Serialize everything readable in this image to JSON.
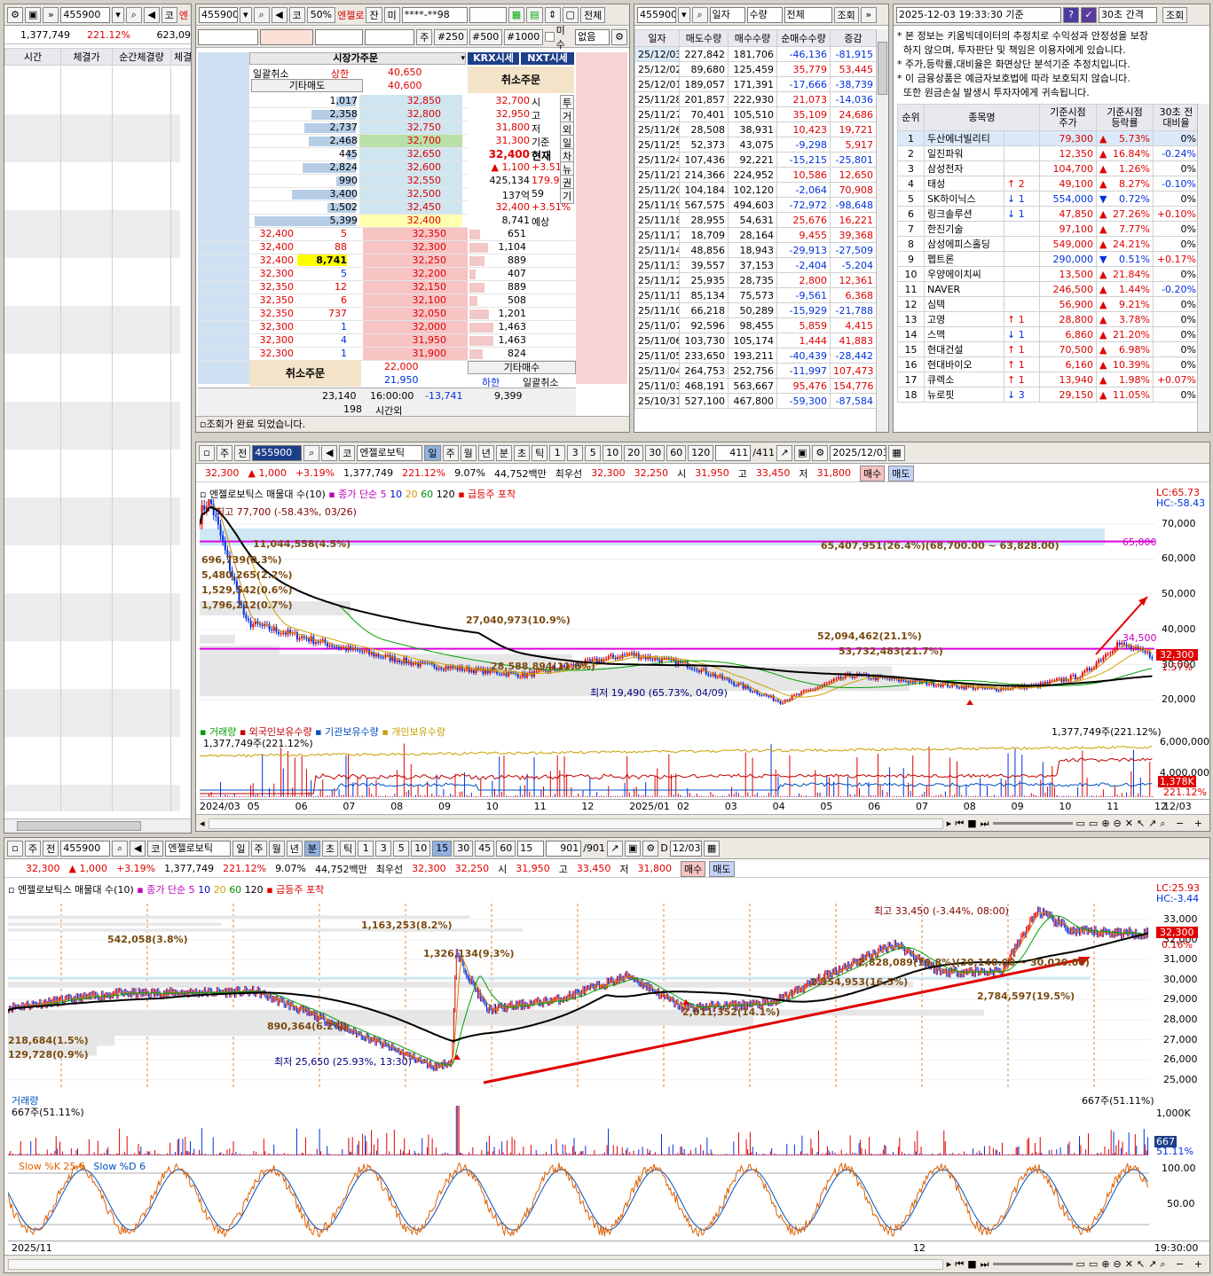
{
  "p1": {
    "code": "455900",
    "cat": "코",
    "name": "엔",
    "price": "1,377,749",
    "ratio": "221.12%",
    "extra": "623,09",
    "headers": [
      "시간",
      "체결가",
      "순간체결량",
      "체결"
    ]
  },
  "p2": {
    "code": "455900",
    "cat": "코",
    "pct": "50%",
    "name": "엔젤로",
    "jan": "잔",
    "mi": "미",
    "account": "****-**98",
    "whole": "전체",
    "ju": "주",
    "q250": "#250",
    "q500": "#500",
    "q1000": "#1000",
    "misu": "미수",
    "none": "없음",
    "market_order": "시장가주문",
    "cancel_label": "일괄취소",
    "etc_sell": "기타매도",
    "upper": "상한",
    "upper_price": "40,650",
    "price2": "40,600",
    "krx": "KRX시세",
    "nxt": "NXT시세",
    "cancel_order": "취소주문",
    "asks": [
      {
        "qty": "1,017",
        "price": "32,850",
        "bar": 0.18
      },
      {
        "qty": "2,358",
        "price": "32,800",
        "bar": 0.42
      },
      {
        "qty": "2,737",
        "price": "32,750",
        "bar": 0.48
      },
      {
        "qty": "2,468",
        "price": "32,700",
        "bar": 0.44
      },
      {
        "qty": "445",
        "price": "32,650",
        "bar": 0.08
      },
      {
        "qty": "2,824",
        "price": "32,600",
        "bar": 0.5
      },
      {
        "qty": "990",
        "price": "32,550",
        "bar": 0.18
      },
      {
        "qty": "3,400",
        "price": "32,500",
        "bar": 0.6
      },
      {
        "qty": "1,502",
        "price": "32,450",
        "bar": 0.27
      },
      {
        "qty": "5,399",
        "price": "32,400",
        "bar": 0.95
      }
    ],
    "info_rows": [
      {
        "v": "32,700",
        "k": "시",
        "side": "투"
      },
      {
        "v": "32,950",
        "k": "고",
        "side": "거"
      },
      {
        "v": "31,800",
        "k": "저",
        "side": "외"
      },
      {
        "v": "31,300",
        "k": "기준",
        "side": "일"
      },
      {
        "v": "32,400",
        "k": "현재",
        "side": "차"
      },
      {
        "v": "▲ 1,100",
        "k": "+3.51%",
        "side": "뉴"
      },
      {
        "v": "425,134",
        "k": "179.99",
        "side": "권"
      },
      {
        "v": "137억",
        "k": "59",
        "side": "기"
      },
      {
        "v": "32,400",
        "k": "+3.51%",
        "side": ""
      },
      {
        "v": "8,741",
        "k": "예상",
        "side": ""
      }
    ],
    "fills": [
      {
        "p": "32,400",
        "q": "5"
      },
      {
        "p": "32,400",
        "q": "88"
      },
      {
        "p": "32,400",
        "q": "8,741"
      },
      {
        "p": "32,300",
        "q": "5"
      },
      {
        "p": "32,350",
        "q": "12"
      },
      {
        "p": "32,350",
        "q": "6"
      },
      {
        "p": "32,350",
        "q": "737"
      },
      {
        "p": "32,300",
        "q": "1"
      },
      {
        "p": "32,300",
        "q": "4"
      },
      {
        "p": "32,300",
        "q": "1"
      }
    ],
    "bids": [
      {
        "price": "32,350",
        "qty": "651",
        "bar": 0.1
      },
      {
        "price": "32,300",
        "qty": "1,104",
        "bar": 0.18
      },
      {
        "price": "32,250",
        "qty": "889",
        "bar": 0.14
      },
      {
        "price": "32,200",
        "qty": "407",
        "bar": 0.06
      },
      {
        "price": "32,150",
        "qty": "889",
        "bar": 0.14
      },
      {
        "price": "32,100",
        "qty": "508",
        "bar": 0.08
      },
      {
        "price": "32,050",
        "qty": "1,201",
        "bar": 0.19
      },
      {
        "price": "32,000",
        "qty": "1,463",
        "bar": 0.23
      },
      {
        "price": "31,950",
        "qty": "1,463",
        "bar": 0.23
      },
      {
        "price": "31,900",
        "qty": "824",
        "bar": 0.13
      }
    ],
    "lower_p1": "22,000",
    "lower_p2": "21,950",
    "lower": "하한",
    "etc_buy": "기타매수",
    "sum_ask": "23,140",
    "time": "16:00:00",
    "diff": "-13,741",
    "sum_bid": "9,399",
    "after": "198",
    "after_label": "시간외",
    "status": "조회가 완료 되었습니다."
  },
  "p3": {
    "code": "455900",
    "sel1": "일자",
    "sel2": "수량",
    "sel3": "전체",
    "query": "조회",
    "headers": [
      "일자",
      "매도수량",
      "매수수량",
      "순매수수량",
      "증감"
    ],
    "rows": [
      [
        "25/12/03",
        "227,842",
        "181,706",
        "-46,136",
        "-81,915"
      ],
      [
        "25/12/02",
        "89,680",
        "125,459",
        "35,779",
        "53,445"
      ],
      [
        "25/12/01",
        "189,057",
        "171,391",
        "-17,666",
        "-38,739"
      ],
      [
        "25/11/28",
        "201,857",
        "222,930",
        "21,073",
        "-14,036"
      ],
      [
        "25/11/27",
        "70,401",
        "105,510",
        "35,109",
        "24,686"
      ],
      [
        "25/11/26",
        "28,508",
        "38,931",
        "10,423",
        "19,721"
      ],
      [
        "25/11/25",
        "52,373",
        "43,075",
        "-9,298",
        "5,917"
      ],
      [
        "25/11/24",
        "107,436",
        "92,221",
        "-15,215",
        "-25,801"
      ],
      [
        "25/11/21",
        "214,366",
        "224,952",
        "10,586",
        "12,650"
      ],
      [
        "25/11/20",
        "104,184",
        "102,120",
        "-2,064",
        "70,908"
      ],
      [
        "25/11/19",
        "567,575",
        "494,603",
        "-72,972",
        "-98,648"
      ],
      [
        "25/11/18",
        "28,955",
        "54,631",
        "25,676",
        "16,221"
      ],
      [
        "25/11/17",
        "18,709",
        "28,164",
        "9,455",
        "39,368"
      ],
      [
        "25/11/14",
        "48,856",
        "18,943",
        "-29,913",
        "-27,509"
      ],
      [
        "25/11/13",
        "39,557",
        "37,153",
        "-2,404",
        "-5,204"
      ],
      [
        "25/11/12",
        "25,935",
        "28,735",
        "2,800",
        "12,361"
      ],
      [
        "25/11/11",
        "85,134",
        "75,573",
        "-9,561",
        "6,368"
      ],
      [
        "25/11/10",
        "66,218",
        "50,289",
        "-15,929",
        "-21,788"
      ],
      [
        "25/11/07",
        "92,596",
        "98,455",
        "5,859",
        "4,415"
      ],
      [
        "25/11/06",
        "103,730",
        "105,174",
        "1,444",
        "41,883"
      ],
      [
        "25/11/05",
        "233,650",
        "193,211",
        "-40,439",
        "-28,442"
      ],
      [
        "25/11/04",
        "264,753",
        "252,756",
        "-11,997",
        "107,473"
      ],
      [
        "25/11/03",
        "468,191",
        "563,667",
        "95,476",
        "154,776"
      ],
      [
        "25/10/31",
        "527,100",
        "467,800",
        "-59,300",
        "-87,584"
      ]
    ]
  },
  "p4": {
    "datetime": "2025-12-03 19:33:30 기준",
    "q": "?",
    "interval": "30초 간격",
    "query": "조회",
    "notice": [
      "* 본 정보는 키움빅데이터의 추정치로 수익성과 안정성을 보장",
      "  하지 않으며, 투자판단 및 책임은 이용자에게 있습니다.",
      "* 주가,등락률,대비율은 화면상단 분석기준 추정치입니다.",
      "* 이 금융상품은 예금자보호법에 따라 보호되지 않습니다.",
      "  또한 원금손실 발생시 투자자에게 귀속됩니다."
    ],
    "headers": [
      "순위",
      "종목명",
      "",
      "기준시점\n주가",
      "기준시점\n등락률",
      "30초 전\n대비율"
    ],
    "rows": [
      [
        "1",
        "두산에너빌리티",
        "",
        "79,300",
        "▲",
        "5.73%",
        "0%"
      ],
      [
        "2",
        "일진파워",
        "",
        "12,350",
        "▲",
        "16.84%",
        "-0.24%"
      ],
      [
        "3",
        "삼성전자",
        "",
        "104,700",
        "▲",
        "1.26%",
        "0%"
      ],
      [
        "4",
        "태성",
        "↑ 2",
        "49,100",
        "▲",
        "8.27%",
        "-0.10%"
      ],
      [
        "5",
        "SK하이닉스",
        "↓ 1",
        "554,000",
        "▼",
        "0.72%",
        "0%"
      ],
      [
        "6",
        "링크솔루션",
        "↓ 1",
        "47,850",
        "▲",
        "27.26%",
        "+0.10%"
      ],
      [
        "7",
        "한진기술",
        "",
        "97,100",
        "▲",
        "7.77%",
        "0%"
      ],
      [
        "8",
        "삼성에피스홀딩",
        "",
        "549,000",
        "▲",
        "24.21%",
        "0%"
      ],
      [
        "9",
        "펩트론",
        "",
        "290,000",
        "▼",
        "0.51%",
        "+0.17%"
      ],
      [
        "10",
        "우양에이치씨",
        "",
        "13,500",
        "▲",
        "21.84%",
        "0%"
      ],
      [
        "11",
        "NAVER",
        "",
        "246,500",
        "▲",
        "1.44%",
        "-0.20%"
      ],
      [
        "12",
        "심텍",
        "",
        "56,900",
        "▲",
        "9.21%",
        "0%"
      ],
      [
        "13",
        "고영",
        "↑ 1",
        "28,800",
        "▲",
        "3.78%",
        "0%"
      ],
      [
        "14",
        "스맥",
        "↓ 1",
        "6,860",
        "▲",
        "21.20%",
        "0%"
      ],
      [
        "15",
        "현대건설",
        "↑ 1",
        "70,500",
        "▲",
        "6.98%",
        "0%"
      ],
      [
        "16",
        "현대바이오",
        "↑ 1",
        "6,160",
        "▲",
        "10.39%",
        "0%"
      ],
      [
        "17",
        "큐렉소",
        "↑ 1",
        "13,940",
        "▲",
        "1.98%",
        "+0.07%"
      ],
      [
        "18",
        "뉴로핏",
        "↓ 3",
        "29,150",
        "▲",
        "11.05%",
        "0%"
      ]
    ]
  },
  "ctop": {
    "code": "455900",
    "cat": "코",
    "name": "엔젤로보틱",
    "periods": [
      "일",
      "주",
      "월",
      "년",
      "분",
      "초",
      "틱"
    ],
    "nums": [
      "1",
      "3",
      "5",
      "10",
      "20",
      "30",
      "60",
      "120"
    ],
    "count": "411",
    "count_total": "/411",
    "date": "2025/12/03",
    "price": "32,300",
    "change": "▲  1,000",
    "rate": "+3.19%",
    "volume": "1,377,749",
    "vratio": "221.12%",
    "turnover": "9.07%",
    "amount": "44,752백만",
    "best_label": "최우선",
    "best_ask": "32,300",
    "best_bid": "32,250",
    "open_label": "시",
    "open": "31,950",
    "high_label": "고",
    "high": "33,450",
    "low_label": "저",
    "low": "31,800",
    "buy": "매수",
    "sell": "매도",
    "legend1": "엔젤로보틱스 매물대 수(10)",
    "legend2": "종가 단순 5",
    "legend_ma": [
      "10",
      "20",
      "60",
      "120"
    ],
    "legend3": "급등주 포착",
    "lc": "LC:65.73",
    "hc": "HC:-58.43",
    "high_note": "최고 77,700 (-58.43%, 03/26)",
    "low_note": "최저 19,490 (65.73%, 04/09)",
    "vol_labels": [
      {
        "t": "11,044,558(4.5%)",
        "x": 60,
        "y": 86
      },
      {
        "t": "696,739(0.3%)",
        "x": 2,
        "y": 104
      },
      {
        "t": "5,480,265(2.2%)",
        "x": 2,
        "y": 121
      },
      {
        "t": "1,529,542(0.6%)",
        "x": 2,
        "y": 138
      },
      {
        "t": "1,796,212(0.7%)",
        "x": 2,
        "y": 155
      },
      {
        "t": "27,040,973(10.9%)",
        "x": 300,
        "y": 172
      },
      {
        "t": "52,094,462(21.1%)",
        "x": 696,
        "y": 190
      },
      {
        "t": "53,732,483(21.7%)",
        "x": 720,
        "y": 207
      },
      {
        "t": "28,588,894(11.6%)",
        "x": 328,
        "y": 224
      }
    ],
    "top_band_label": "65,407,951(26.4%)(68,700.00 ~ 63,828.00)",
    "line_a": "65,000",
    "line_b": "34,500",
    "cur_tag": "32,300",
    "cur_pct": "1.57%",
    "yticks": [
      "70,000",
      "60,000",
      "50,000",
      "40,000",
      "30,000",
      "20,000"
    ],
    "vol_legend": [
      "거래량",
      "외국인보유수량",
      "기관보유수량",
      "개인보유수량"
    ],
    "vol_left": "1,377,749주(221.12%)",
    "vol_right": "1,377,749주(221.12%)",
    "vol_ticks": [
      "6,000,000",
      "4,000,000"
    ],
    "vol_tag": "1,378K",
    "vol_tag2": "221.12%",
    "xticks": [
      "2024/03",
      "05",
      "06",
      "07",
      "08",
      "09",
      "10",
      "11",
      "12",
      "2025/01",
      "02",
      "03",
      "04",
      "05",
      "06",
      "07",
      "08",
      "09",
      "10",
      "11",
      "12"
    ],
    "xlast": "12/03"
  },
  "cbot": {
    "code": "455900",
    "cat": "코",
    "name": "엔젤로보틱",
    "periods": [
      "일",
      "주",
      "월",
      "년",
      "분",
      "초",
      "틱"
    ],
    "nums": [
      "1",
      "3",
      "5",
      "10",
      "15",
      "30",
      "45",
      "60"
    ],
    "sel_min": "15",
    "count": "901",
    "count_total": "/901",
    "d": "D",
    "date": "12/03",
    "price": "32,300",
    "change": "▲  1,000",
    "rate": "+3.19%",
    "volume": "1,377,749",
    "vratio": "221.12%",
    "turnover": "9.07%",
    "amount": "44,752백만",
    "best_label": "최우선",
    "best_ask": "32,300",
    "best_bid": "32,250",
    "open_label": "시",
    "open": "31,950",
    "high_label": "고",
    "high": "33,450",
    "low_label": "저",
    "low": "31,800",
    "buy": "매수",
    "sell": "매도",
    "legend1": "엔젤로보틱스 매물대 수(10)",
    "legend2": "종가 단순 5",
    "legend_ma": [
      "10",
      "20",
      "60",
      "120"
    ],
    "legend3": "급등주 포착",
    "lc": "LC:25.93",
    "hc": "HC:-3.44",
    "high_note": "최고 33,450 (-3.44%, 08:00)",
    "low_note": "최저 25,650 (25.93%, 13:30)",
    "vol_labels": [
      {
        "t": "1,163,253(8.2%)",
        "x": 398,
        "y": 22
      },
      {
        "t": "542,058(3.8%)",
        "x": 112,
        "y": 38
      },
      {
        "t": "1,326,134(9.3%)",
        "x": 468,
        "y": 54
      },
      {
        "t": "2,354,953(16.5%)",
        "x": 904,
        "y": 86
      },
      {
        "t": "2,784,597(19.5%)",
        "x": 1092,
        "y": 102
      },
      {
        "t": "2,011,352(14.1%)",
        "x": 760,
        "y": 120
      },
      {
        "t": "890,364(6.2%)",
        "x": 292,
        "y": 136
      },
      {
        "t": "218,684(1.5%)",
        "x": 0,
        "y": 152
      },
      {
        "t": "129,728(0.9%)",
        "x": 0,
        "y": 168
      }
    ],
    "band_label": "2,828,089(19.8%)(30,140.00 ~ 30,020.00)",
    "cur_tag": "32,300",
    "cur_pct": "0.16%",
    "yticks": [
      "33,000",
      "32,000",
      "31,000",
      "30,000",
      "29,000",
      "28,000",
      "27,000",
      "26,000",
      "25,000"
    ],
    "vol_legend": "거래량",
    "vol_left": "667주(51.11%)",
    "vol_right": "667주(51.11%)",
    "vol_tick": "1,000K",
    "vol_tag": "667",
    "vol_tag2": "51.11%",
    "stoch_legend": "Slow %K 25,6",
    "stoch_legend2": "Slow %D 6",
    "stoch_ticks": [
      "100.00",
      "50.00"
    ],
    "x_left": "2025/11",
    "x_mid": "12",
    "x_right": "19:30:00"
  }
}
